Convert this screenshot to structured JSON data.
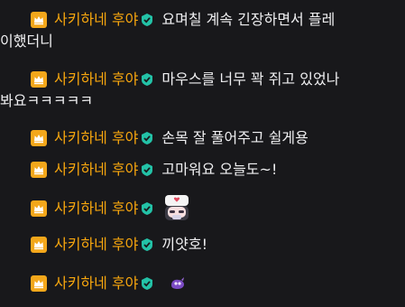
{
  "colors": {
    "background": "#18181b",
    "username": "#f7a60e",
    "message_text": "#efeff1",
    "badge_bg": "#f3a71b",
    "verified_teal": "#23c2a7"
  },
  "messages": [
    {
      "username": "사키하네 후야",
      "badge_icon": "crown-badge-icon",
      "verified_icon": "verified-check-icon",
      "text_line1": "요며칠 계속 긴장하면서 플레",
      "text_line2": "이했더니"
    },
    {
      "username": "사키하네 후야",
      "badge_icon": "crown-badge-icon",
      "verified_icon": "verified-check-icon",
      "text_line1": "마우스를 너무 꽉 쥐고 있었나",
      "text_line2": "봐요ㅋㅋㅋㅋㅋ"
    },
    {
      "username": "사키하네 후야",
      "badge_icon": "crown-badge-icon",
      "verified_icon": "verified-check-icon",
      "text_line1": "손목 잘 풀어주고 쉴게용"
    },
    {
      "username": "사키하네 후야",
      "badge_icon": "crown-badge-icon",
      "verified_icon": "verified-check-icon",
      "text_line1": "고마워요 오늘도~!"
    },
    {
      "username": "사키하네 후야",
      "badge_icon": "crown-badge-icon",
      "verified_icon": "verified-check-icon",
      "emote": "nurse-emote-icon"
    },
    {
      "username": "사키하네 후야",
      "badge_icon": "crown-badge-icon",
      "verified_icon": "verified-check-icon",
      "text_line1": "끼얏호!"
    },
    {
      "username": "사키하네 후야",
      "badge_icon": "crown-badge-icon",
      "verified_icon": "verified-check-icon",
      "emote": "purple-creature-emote-icon"
    }
  ]
}
